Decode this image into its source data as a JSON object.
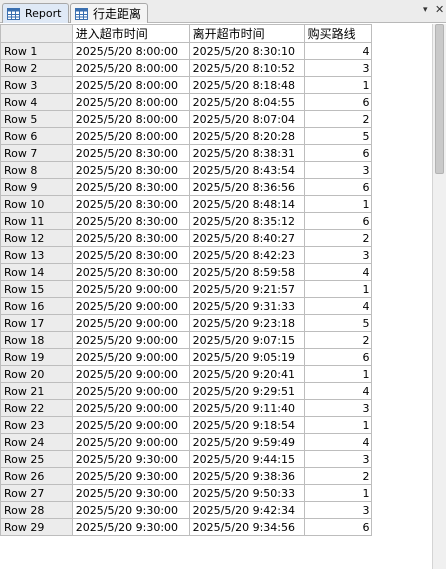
{
  "tabs": [
    {
      "label": "Report",
      "icon": "table-icon",
      "active": true
    },
    {
      "label": "行走距离",
      "icon": "table-icon",
      "active": false
    }
  ],
  "window_controls": {
    "dropdown": "▾",
    "close": "✕"
  },
  "table": {
    "columns": [
      "",
      "进入超市时间",
      "离开超市时间",
      "购买路线"
    ],
    "rows": [
      [
        "Row 1",
        "2025/5/20 8:00:00",
        "2025/5/20 8:30:10",
        "4"
      ],
      [
        "Row 2",
        "2025/5/20 8:00:00",
        "2025/5/20 8:10:52",
        "3"
      ],
      [
        "Row 3",
        "2025/5/20 8:00:00",
        "2025/5/20 8:18:48",
        "1"
      ],
      [
        "Row 4",
        "2025/5/20 8:00:00",
        "2025/5/20 8:04:55",
        "6"
      ],
      [
        "Row 5",
        "2025/5/20 8:00:00",
        "2025/5/20 8:07:04",
        "2"
      ],
      [
        "Row 6",
        "2025/5/20 8:00:00",
        "2025/5/20 8:20:28",
        "5"
      ],
      [
        "Row 7",
        "2025/5/20 8:30:00",
        "2025/5/20 8:38:31",
        "6"
      ],
      [
        "Row 8",
        "2025/5/20 8:30:00",
        "2025/5/20 8:43:54",
        "3"
      ],
      [
        "Row 9",
        "2025/5/20 8:30:00",
        "2025/5/20 8:36:56",
        "6"
      ],
      [
        "Row 10",
        "2025/5/20 8:30:00",
        "2025/5/20 8:48:14",
        "1"
      ],
      [
        "Row 11",
        "2025/5/20 8:30:00",
        "2025/5/20 8:35:12",
        "6"
      ],
      [
        "Row 12",
        "2025/5/20 8:30:00",
        "2025/5/20 8:40:27",
        "2"
      ],
      [
        "Row 13",
        "2025/5/20 8:30:00",
        "2025/5/20 8:42:23",
        "3"
      ],
      [
        "Row 14",
        "2025/5/20 8:30:00",
        "2025/5/20 8:59:58",
        "4"
      ],
      [
        "Row 15",
        "2025/5/20 9:00:00",
        "2025/5/20 9:21:57",
        "1"
      ],
      [
        "Row 16",
        "2025/5/20 9:00:00",
        "2025/5/20 9:31:33",
        "4"
      ],
      [
        "Row 17",
        "2025/5/20 9:00:00",
        "2025/5/20 9:23:18",
        "5"
      ],
      [
        "Row 18",
        "2025/5/20 9:00:00",
        "2025/5/20 9:07:15",
        "2"
      ],
      [
        "Row 19",
        "2025/5/20 9:00:00",
        "2025/5/20 9:05:19",
        "6"
      ],
      [
        "Row 20",
        "2025/5/20 9:00:00",
        "2025/5/20 9:20:41",
        "1"
      ],
      [
        "Row 21",
        "2025/5/20 9:00:00",
        "2025/5/20 9:29:51",
        "4"
      ],
      [
        "Row 22",
        "2025/5/20 9:00:00",
        "2025/5/20 9:11:40",
        "3"
      ],
      [
        "Row 23",
        "2025/5/20 9:00:00",
        "2025/5/20 9:18:54",
        "1"
      ],
      [
        "Row 24",
        "2025/5/20 9:00:00",
        "2025/5/20 9:59:49",
        "4"
      ],
      [
        "Row 25",
        "2025/5/20 9:30:00",
        "2025/5/20 9:44:15",
        "3"
      ],
      [
        "Row 26",
        "2025/5/20 9:30:00",
        "2025/5/20 9:38:36",
        "2"
      ],
      [
        "Row 27",
        "2025/5/20 9:30:00",
        "2025/5/20 9:50:33",
        "1"
      ],
      [
        "Row 28",
        "2025/5/20 9:30:00",
        "2025/5/20 9:42:34",
        "3"
      ],
      [
        "Row 29",
        "2025/5/20 9:30:00",
        "2025/5/20 9:34:56",
        "6"
      ]
    ]
  },
  "colors": {
    "tab_active_bg": "#dfe9f6",
    "row_header_bg": "#ececec",
    "grid_line": "#bdbdbd",
    "icon_blue": "#3a6fb0"
  }
}
